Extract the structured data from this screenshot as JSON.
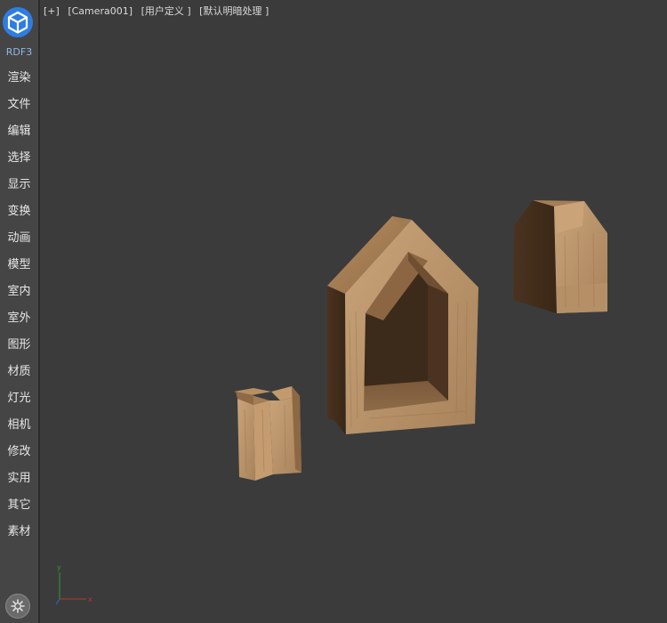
{
  "app": {
    "brand": "RDF3",
    "logo_icon": "cube-logo-icon",
    "accent": "#2f7de1"
  },
  "sidebar": {
    "items": [
      {
        "label": "渲染"
      },
      {
        "label": "文件"
      },
      {
        "label": "编辑"
      },
      {
        "label": "选择"
      },
      {
        "label": "显示"
      },
      {
        "label": "变换"
      },
      {
        "label": "动画"
      },
      {
        "label": "模型"
      },
      {
        "label": "室内"
      },
      {
        "label": "室外"
      },
      {
        "label": "图形"
      },
      {
        "label": "材质"
      },
      {
        "label": "灯光"
      },
      {
        "label": "相机"
      },
      {
        "label": "修改"
      },
      {
        "label": "实用"
      },
      {
        "label": "其它"
      },
      {
        "label": "素材"
      }
    ],
    "settings_icon": "gear-icon"
  },
  "viewport": {
    "menu_plus": "[+]",
    "camera": "[Camera001]",
    "view_mode": "[用户定义 ]",
    "shading": "[默认明暗处理 ]",
    "axis_icon": "axis-gizmo-icon",
    "objects": [
      "wooden-house-frame",
      "wooden-house-block",
      "wooden-cross-piece"
    ]
  }
}
